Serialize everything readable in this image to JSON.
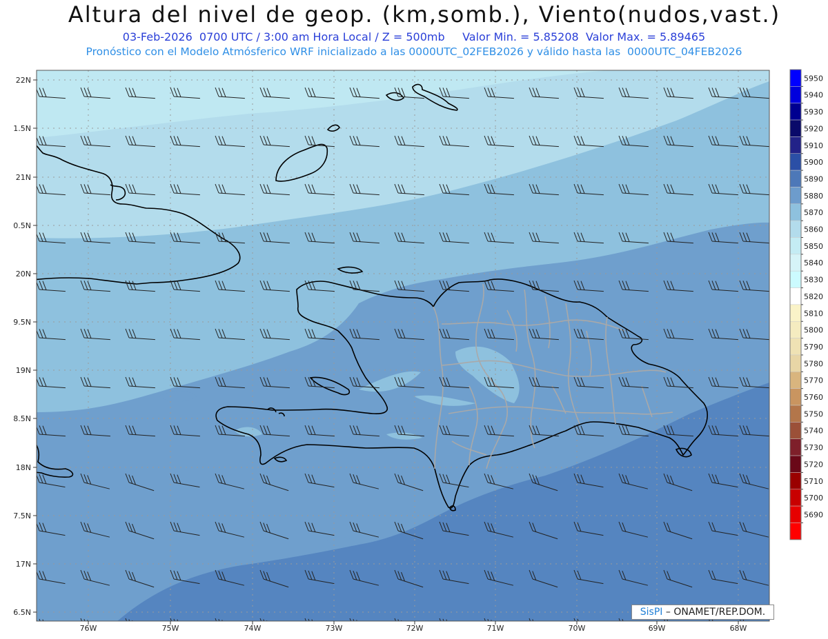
{
  "header": {
    "title": "Altura del nivel de geop. (km,somb.), Viento(nudos,vast.)",
    "subtitle_1": "03-Feb-2026  0700 UTC / 3:00 am Hora Local / Z = 500mb     Valor Min. = 5.85208  Valor Max. = 5.89465",
    "subtitle_2": "Pronóstico con el Modelo Atmósferico WRF inicializado a las 0000UTC_02FEB2026 y válido hasta las  0000UTC_04FEB2026"
  },
  "map": {
    "lat_ticks": [
      "22N",
      "1.5N",
      "21N",
      "0.5N",
      "20N",
      "9.5N",
      "19N",
      "8.5N",
      "18N",
      "7.5N",
      "17N",
      "6.5N"
    ],
    "lon_ticks": [
      "76W",
      "75W",
      "74W",
      "73W",
      "72W",
      "71W",
      "70W",
      "69W",
      "68W"
    ],
    "field_colors": {
      "band_5850": "#bfe8f2",
      "band_5860": "#b3dcec",
      "band_5870": "#8ec1de",
      "band_5880": "#6f9fcd",
      "band_5890": "#5585c0",
      "coast": "#000000",
      "provinces": "#a9a9a9"
    }
  },
  "colorbar": {
    "levels": [
      "5950",
      "5940",
      "5930",
      "5920",
      "5910",
      "5900",
      "5890",
      "5880",
      "5870",
      "5860",
      "5850",
      "5840",
      "5830",
      "5820",
      "5810",
      "5800",
      "5790",
      "5780",
      "5770",
      "5760",
      "5750",
      "5740",
      "5730",
      "5720",
      "5710",
      "5700",
      "5690"
    ],
    "colors": [
      "#0000ff",
      "#0000dd",
      "#000090",
      "#0a0a6a",
      "#222288",
      "#2b4fa6",
      "#4d78b8",
      "#6d9ccc",
      "#8ec1de",
      "#b3dcec",
      "#c4ecf4",
      "#d6f4f8",
      "#ccfbff",
      "#ffffff",
      "#faf3c8",
      "#f5ecc0",
      "#efe2b4",
      "#e8d6a6",
      "#d9b57e",
      "#c99560",
      "#b3764a",
      "#9b5038",
      "#7e1f2a",
      "#6a0818",
      "#9a0000",
      "#c80000",
      "#e60000",
      "#ff0000"
    ]
  },
  "credit": {
    "brand": "SisPI",
    "org": " – ONAMET/REP.DOM."
  }
}
